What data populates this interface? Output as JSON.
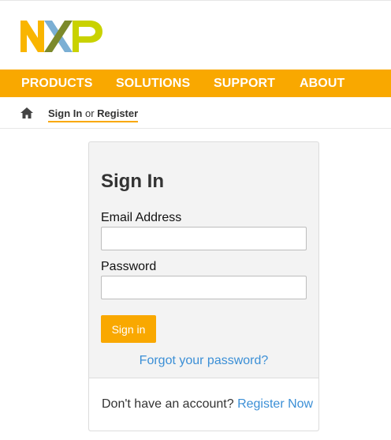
{
  "header": {
    "logo_text": "NXP",
    "logo_colors": {
      "n": "#f9b500",
      "x_blue": "#7bafd4",
      "x_olive": "#7c8a2b",
      "p": "#c9d200"
    }
  },
  "nav": {
    "items": [
      "PRODUCTS",
      "SOLUTIONS",
      "SUPPORT",
      "ABOUT"
    ],
    "bg_color": "#f9a800"
  },
  "breadcrumb": {
    "home_icon": "home-icon",
    "sign_in": "Sign In",
    "or": "or",
    "register": "Register"
  },
  "signin": {
    "title": "Sign In",
    "email_label": "Email Address",
    "email_value": "",
    "password_label": "Password",
    "password_value": "",
    "submit_label": "Sign in",
    "forgot_label": "Forgot your password?",
    "no_account_text": "Don't have an account?",
    "register_label": "Register Now"
  },
  "colors": {
    "accent": "#f9a800",
    "link": "#3b8fd6"
  }
}
